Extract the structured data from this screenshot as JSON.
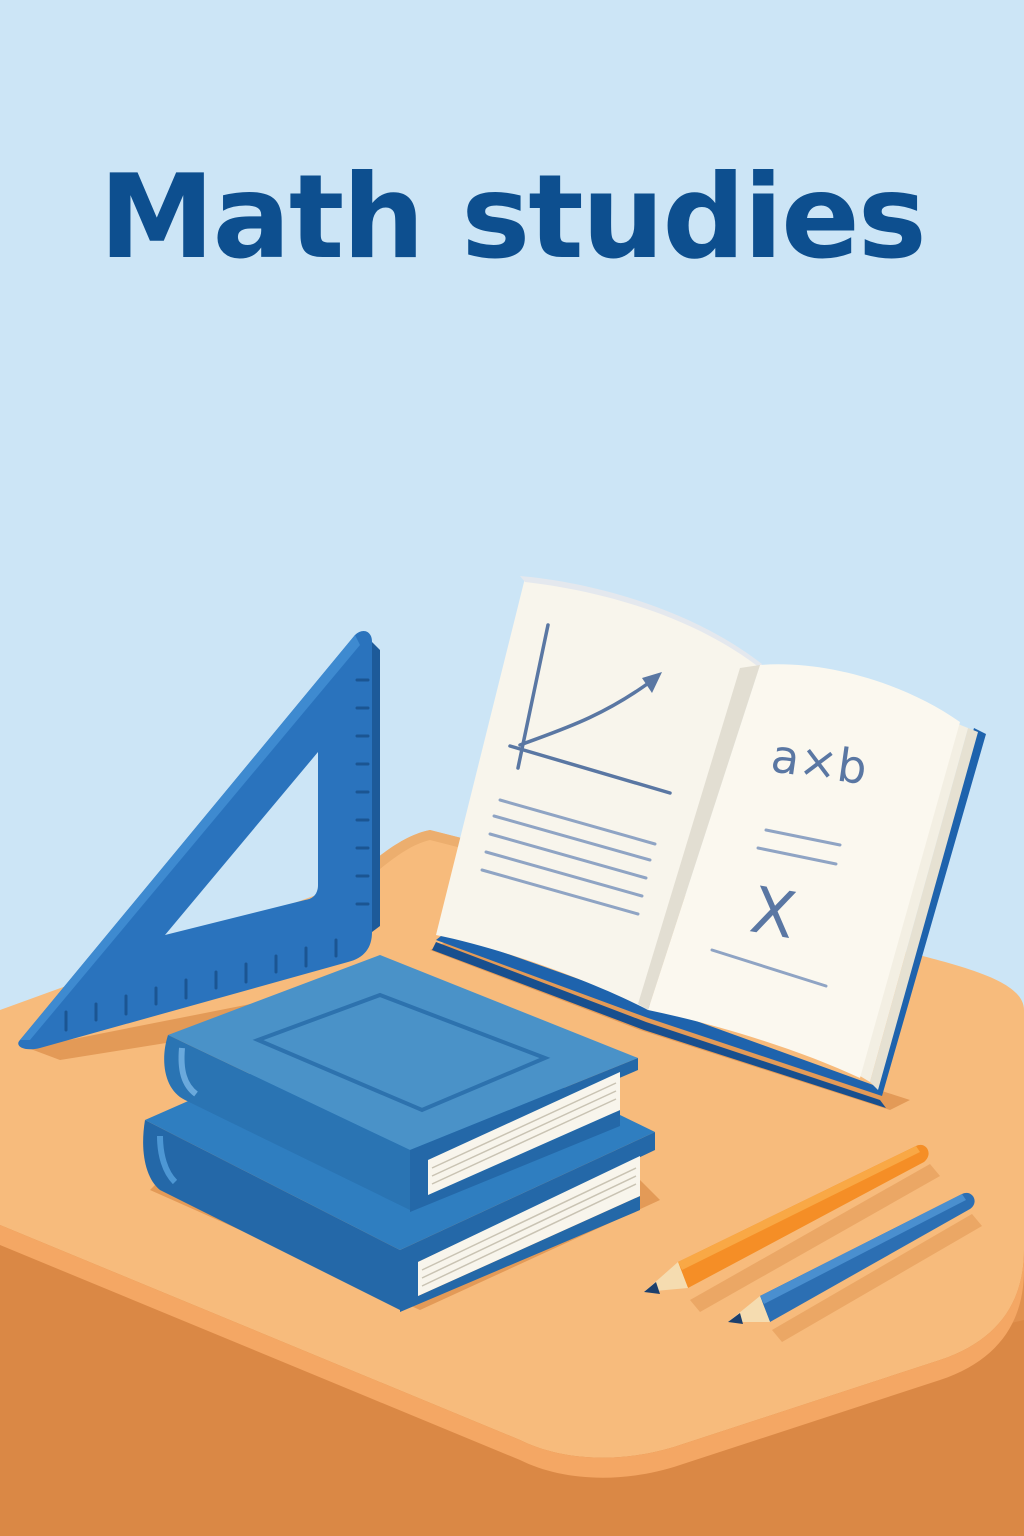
{
  "poster": {
    "title": "Math studies"
  },
  "book": {
    "formula": "a×b",
    "variable": "X"
  },
  "colors": {
    "sky": "#cce5f6",
    "title": "#0d4f8f",
    "desk_top": "#f7bb7c",
    "desk_front": "#e0914f",
    "book_blue": "#2270b3",
    "triangle_blue": "#2a73bd",
    "pencil_orange": "#f58e26",
    "pencil_blue": "#2c6fb3",
    "page_white": "#fbf8ef"
  },
  "icons": [
    "set-square-icon",
    "closed-book-icon",
    "open-book-icon",
    "pencil-icon"
  ]
}
